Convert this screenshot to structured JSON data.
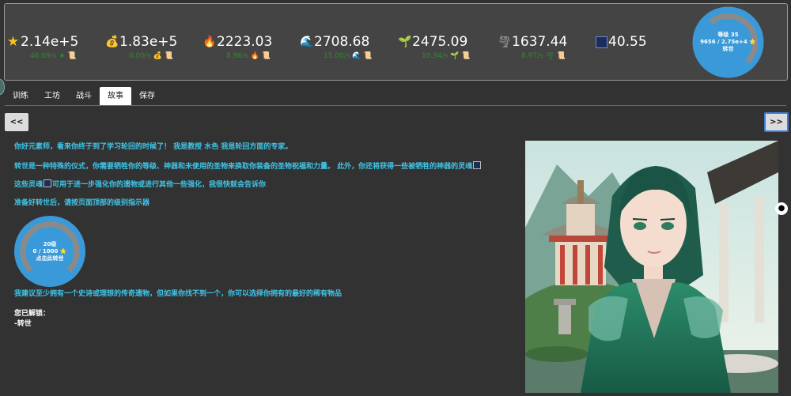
{
  "stats": [
    {
      "icon": "star-icon",
      "glyph": "★",
      "value": "2.14e+5",
      "rate": "46.09/s ★ 📜"
    },
    {
      "icon": "money-bag-icon",
      "glyph": "💰",
      "value": "1.83e+5",
      "rate": "0.00/s 💰 📜"
    },
    {
      "icon": "fire-icon",
      "glyph": "🔥",
      "value": "2223.03",
      "rate": "8.96/s 🔥 📜"
    },
    {
      "icon": "water-icon",
      "glyph": "🌊",
      "value": "2708.68",
      "rate": "15.00/s 🌊 📜"
    },
    {
      "icon": "sprout-icon",
      "glyph": "🌱",
      "value": "2475.09",
      "rate": "10.94/s 🌱 📜"
    },
    {
      "icon": "tornado-icon",
      "glyph": "🌪",
      "value": "1637.44",
      "rate": "8.97/s 🌪 📜"
    },
    {
      "icon": "spellbook-icon",
      "glyph": "",
      "value": "40.55",
      "rate": ""
    }
  ],
  "level_ring": {
    "line1": "等级 35",
    "line2": "9656 / 2.75e+4 ⭐",
    "line3": "转世",
    "progress": 0.35
  },
  "tabs": [
    "训练",
    "工坊",
    "战斗",
    "故事",
    "保存"
  ],
  "active_tab": "故事",
  "nav": {
    "prev": "<<",
    "next": ">>"
  },
  "story": {
    "p1": "你好元素师，看来你终于到了学习轮回的时候了！ 我是教授 水色 我是轮回方面的专家。",
    "p2": "转世是一种特殊的仪式，你需要牺牲你的等级、神器和未使用的圣物来换取你装备的圣物祝福和力量。 此外，你还将获得一些被牺牲的神器的灵魂",
    "p3a": "这些灵魂",
    "p3b": "可用于进一步强化你的遗物或进行其他一些强化，我很快就会告诉你",
    "p4": "准备好转世后，请按页面顶部的级别指示器",
    "p5": "我建议至少拥有一个史诗或理想的传奇遗物，但如果你找不到一个，你可以选择你拥有的最好的稀有物品",
    "unlocked_title": "您已解锁：",
    "unlocked_item": "-转世"
  },
  "mini_ring": {
    "line1": "20级",
    "line2": "0 / 1000 ⭐",
    "line3": "点击此转世",
    "progress": 0.0
  },
  "colors": {
    "accent_blue": "#3a9ad9",
    "story_text": "#3fc5e8",
    "rate_green": "#2e8b2e",
    "background": "#323232"
  }
}
